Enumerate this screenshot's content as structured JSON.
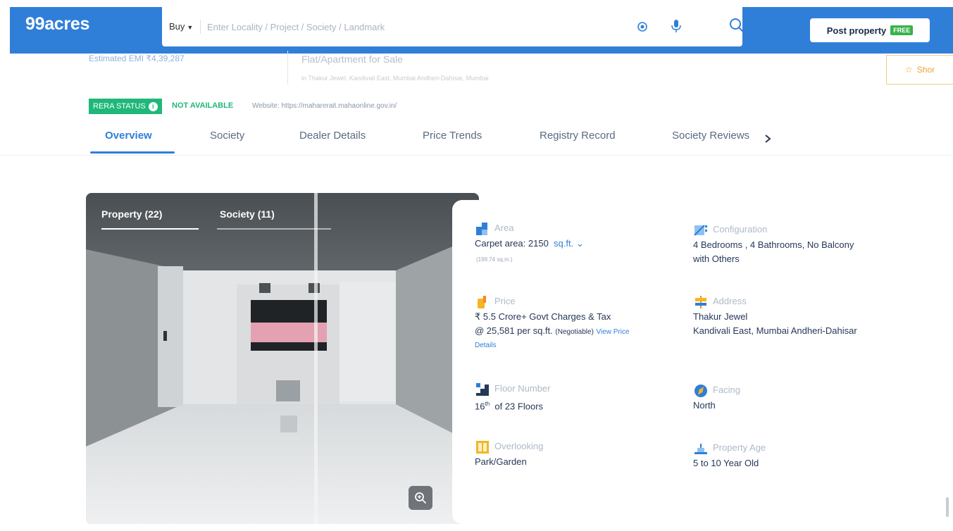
{
  "header": {
    "logo": "99acres",
    "buy_label": "Buy",
    "search_placeholder": "Enter Locality / Project / Society / Landmark",
    "post_property": "Post property",
    "free_badge": "FREE"
  },
  "listing": {
    "emi": "Estimated EMI ₹4,39,287",
    "title": "Flat/Apartment for Sale",
    "subtitle": "in Thakur Jewel, Kandivali East, Mumbai Andheri-Dahisar, Mumbai",
    "shortlist_label": "Shor"
  },
  "rera": {
    "badge": "RERA STATUS",
    "status": "NOT AVAILABLE",
    "website": "Website: https://maharerait.mahaonline.gov.in/"
  },
  "tabs": [
    "Overview",
    "Society",
    "Dealer Details",
    "Price Trends",
    "Registry Record",
    "Society Reviews"
  ],
  "gallery": {
    "tabs": [
      "Property (22)",
      "Society (11)"
    ]
  },
  "details": {
    "area": {
      "label": "Area",
      "value_prefix": "Carpet area: 2150",
      "unit": "sq.ft.",
      "sub": "(199.74 sq.m.)"
    },
    "configuration": {
      "label": "Configuration",
      "line1": "4 Bedrooms , 4 Bathrooms, No Balcony",
      "line2": "with Others"
    },
    "price": {
      "label": "Price",
      "line1": "₹ 5.5 Crore+ Govt Charges & Tax",
      "line2": "@ 25,581 per sq.ft.",
      "negotiable": "(Negotiable)",
      "link1": "View Price",
      "link2": "Details"
    },
    "address": {
      "label": "Address",
      "line1": "Thakur Jewel",
      "line2": "Kandivali East, Mumbai Andheri-Dahisar"
    },
    "floor": {
      "label": "Floor Number",
      "num": "16",
      "sup": "th",
      "rest": "of 23 Floors"
    },
    "facing": {
      "label": "Facing",
      "value": "North"
    },
    "overlooking": {
      "label": "Overlooking",
      "value": "Park/Garden"
    },
    "age": {
      "label": "Property Age",
      "value": "5 to 10 Year Old"
    }
  },
  "colors": {
    "brand_blue": "#2f7fd8",
    "rera_green": "#1fb77a",
    "shortlist_orange": "#f0a030"
  }
}
